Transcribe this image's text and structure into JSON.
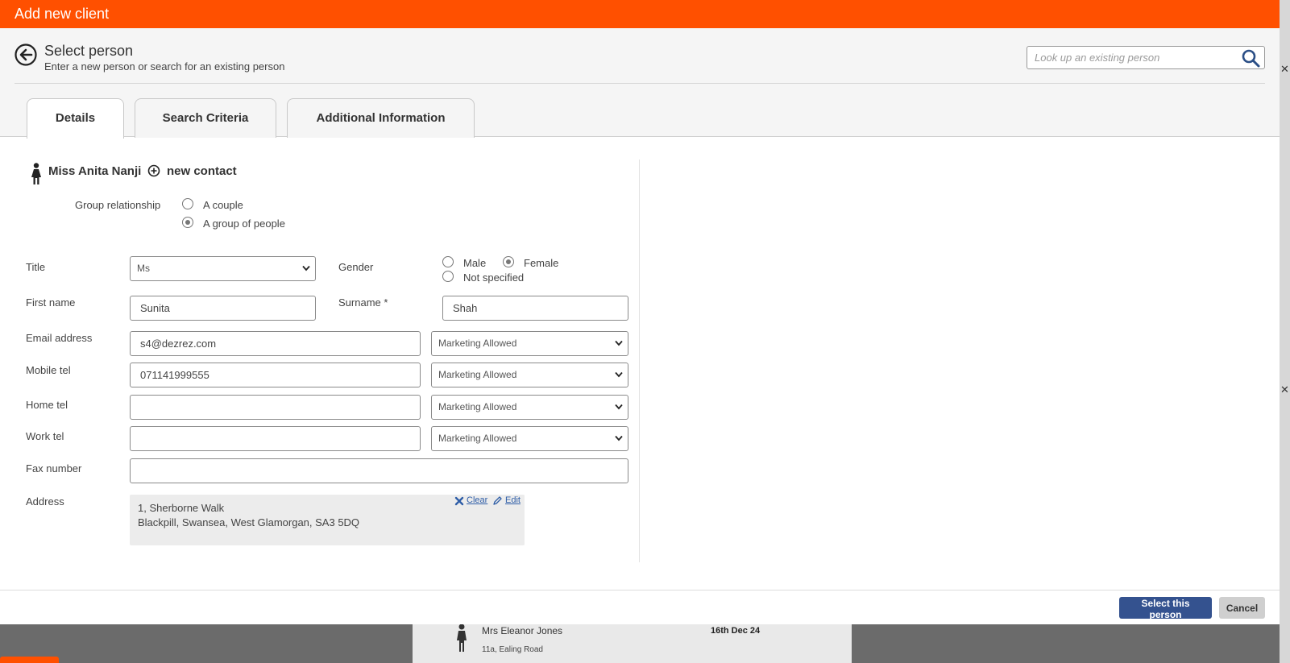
{
  "window": {
    "title": "Add new client"
  },
  "header": {
    "title": "Select person",
    "subtitle": "Enter a new person or search for an existing person",
    "lookup_placeholder": "Look up an existing person"
  },
  "tabs": [
    {
      "label": "Details",
      "active": true
    },
    {
      "label": "Search Criteria",
      "active": false
    },
    {
      "label": "Additional Information",
      "active": false
    }
  ],
  "contact": {
    "name": "Miss Anita Nanji",
    "new_contact_label": "new contact"
  },
  "group": {
    "label": "Group relationship",
    "options": [
      {
        "label": "A couple",
        "checked": false
      },
      {
        "label": "A group of people",
        "checked": true
      }
    ]
  },
  "form": {
    "title_label": "Title",
    "title_value": "Ms",
    "gender_label": "Gender",
    "gender_options": [
      {
        "label": "Male",
        "checked": false
      },
      {
        "label": "Female",
        "checked": true
      },
      {
        "label": "Not specified",
        "checked": false
      }
    ],
    "first_name_label": "First name",
    "first_name_value": "Sunita",
    "surname_label": "Surname *",
    "surname_value": "Shah",
    "email_label": "Email address",
    "email_value": "s4@dezrez.com",
    "email_marketing": "Marketing Allowed",
    "mobile_label": "Mobile tel",
    "mobile_value": "071141999555",
    "mobile_marketing": "Marketing Allowed",
    "home_label": "Home tel",
    "home_value": "",
    "home_marketing": "Marketing Allowed",
    "work_label": "Work tel",
    "work_value": "",
    "work_marketing": "Marketing Allowed",
    "fax_label": "Fax number",
    "fax_value": "",
    "address_label": "Address",
    "address_line1": "1, Sherborne Walk",
    "address_line2": "Blackpill, Swansea, West Glamorgan, SA3 5DQ",
    "clear_label": "Clear",
    "edit_label": "Edit"
  },
  "footer": {
    "select_label": "Select this person",
    "cancel_label": "Cancel"
  },
  "background": {
    "name": "Mrs Eleanor Jones",
    "address": "11a, Ealing Road",
    "date": "16th Dec 24"
  },
  "colors": {
    "titlebar": "#ff5000",
    "primary_button": "#34528f",
    "link": "#2f5ea7"
  }
}
